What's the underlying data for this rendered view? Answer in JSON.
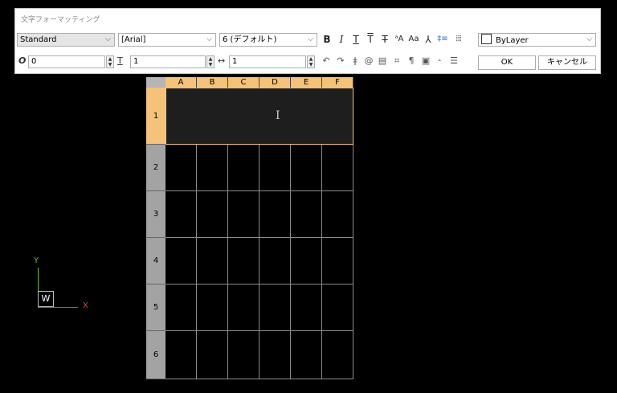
{
  "toolbar": {
    "title": "文字フォーマッティング",
    "style": "Standard",
    "font": "[Arial]",
    "height": "6 (デフォルト)",
    "color": "ByLayer",
    "oblique": "0",
    "tracking": "1",
    "width_factor": "1",
    "ok_label": "OK",
    "cancel_label": "キャンセル",
    "format_icons": {
      "bold": "B",
      "italic": "I",
      "underline": "T",
      "overline": "T",
      "strike": "T",
      "stack": "ᵃA",
      "case": "Aa",
      "symbol": "⅄",
      "line_spacing": "‡≡",
      "columns": "⦙⦙⦙"
    }
  },
  "table": {
    "columns": [
      "A",
      "B",
      "C",
      "D",
      "E",
      "F"
    ],
    "rows": [
      "1",
      "2",
      "3",
      "4",
      "5",
      "6"
    ]
  },
  "ucs": {
    "y": "Y",
    "x": "X",
    "w": "W"
  }
}
